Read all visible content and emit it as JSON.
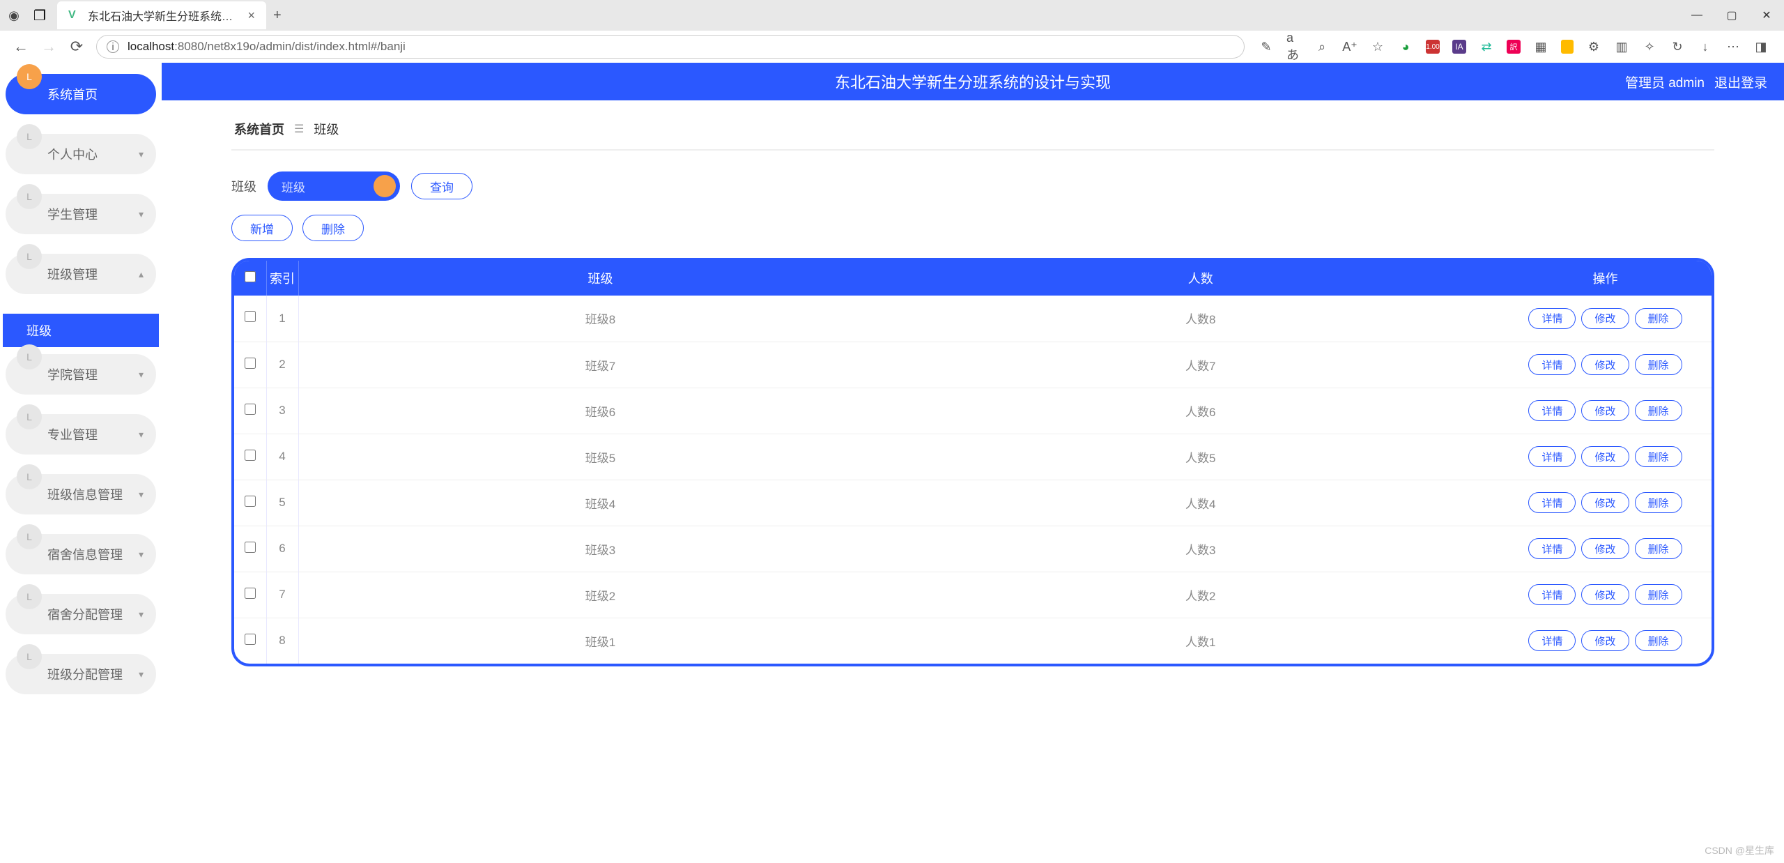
{
  "browser": {
    "tab_title": "东北石油大学新生分班系统的设…",
    "url_host": "localhost",
    "url_rest": ":8080/net8x19o/admin/dist/index.html#/banji",
    "new_tab": "+"
  },
  "header": {
    "title": "东北石油大学新生分班系统的设计与实现",
    "user_label": "管理员 admin",
    "logout": "退出登录"
  },
  "sidebar": {
    "items": [
      {
        "label": "系统首页",
        "active": true,
        "expand": ""
      },
      {
        "label": "个人中心",
        "expand": "▾"
      },
      {
        "label": "学生管理",
        "expand": "▾"
      },
      {
        "label": "班级管理",
        "expand": "▴",
        "open": true
      },
      {
        "label": "班级",
        "sub": true
      },
      {
        "label": "学院管理",
        "expand": "▾"
      },
      {
        "label": "专业管理",
        "expand": "▾"
      },
      {
        "label": "班级信息管理",
        "expand": "▾"
      },
      {
        "label": "宿舍信息管理",
        "expand": "▾"
      },
      {
        "label": "宿舍分配管理",
        "expand": "▾"
      },
      {
        "label": "班级分配管理",
        "expand": "▾"
      }
    ]
  },
  "crumb": {
    "home": "系统首页",
    "current": "班级"
  },
  "filter": {
    "label": "班级",
    "placeholder": "班级",
    "query_btn": "查询"
  },
  "actions": {
    "add": "新增",
    "delete": "删除"
  },
  "table": {
    "headers": {
      "index": "索引",
      "banji": "班级",
      "renshu": "人数",
      "ops": "操作"
    },
    "ops": {
      "detail": "详情",
      "edit": "修改",
      "delete": "删除"
    },
    "rows": [
      {
        "index": "1",
        "banji": "班级8",
        "renshu": "人数8"
      },
      {
        "index": "2",
        "banji": "班级7",
        "renshu": "人数7"
      },
      {
        "index": "3",
        "banji": "班级6",
        "renshu": "人数6"
      },
      {
        "index": "4",
        "banji": "班级5",
        "renshu": "人数5"
      },
      {
        "index": "5",
        "banji": "班级4",
        "renshu": "人数4"
      },
      {
        "index": "6",
        "banji": "班级3",
        "renshu": "人数3"
      },
      {
        "index": "7",
        "banji": "班级2",
        "renshu": "人数2"
      },
      {
        "index": "8",
        "banji": "班级1",
        "renshu": "人数1"
      }
    ]
  },
  "watermark": "CSDN @星生库"
}
